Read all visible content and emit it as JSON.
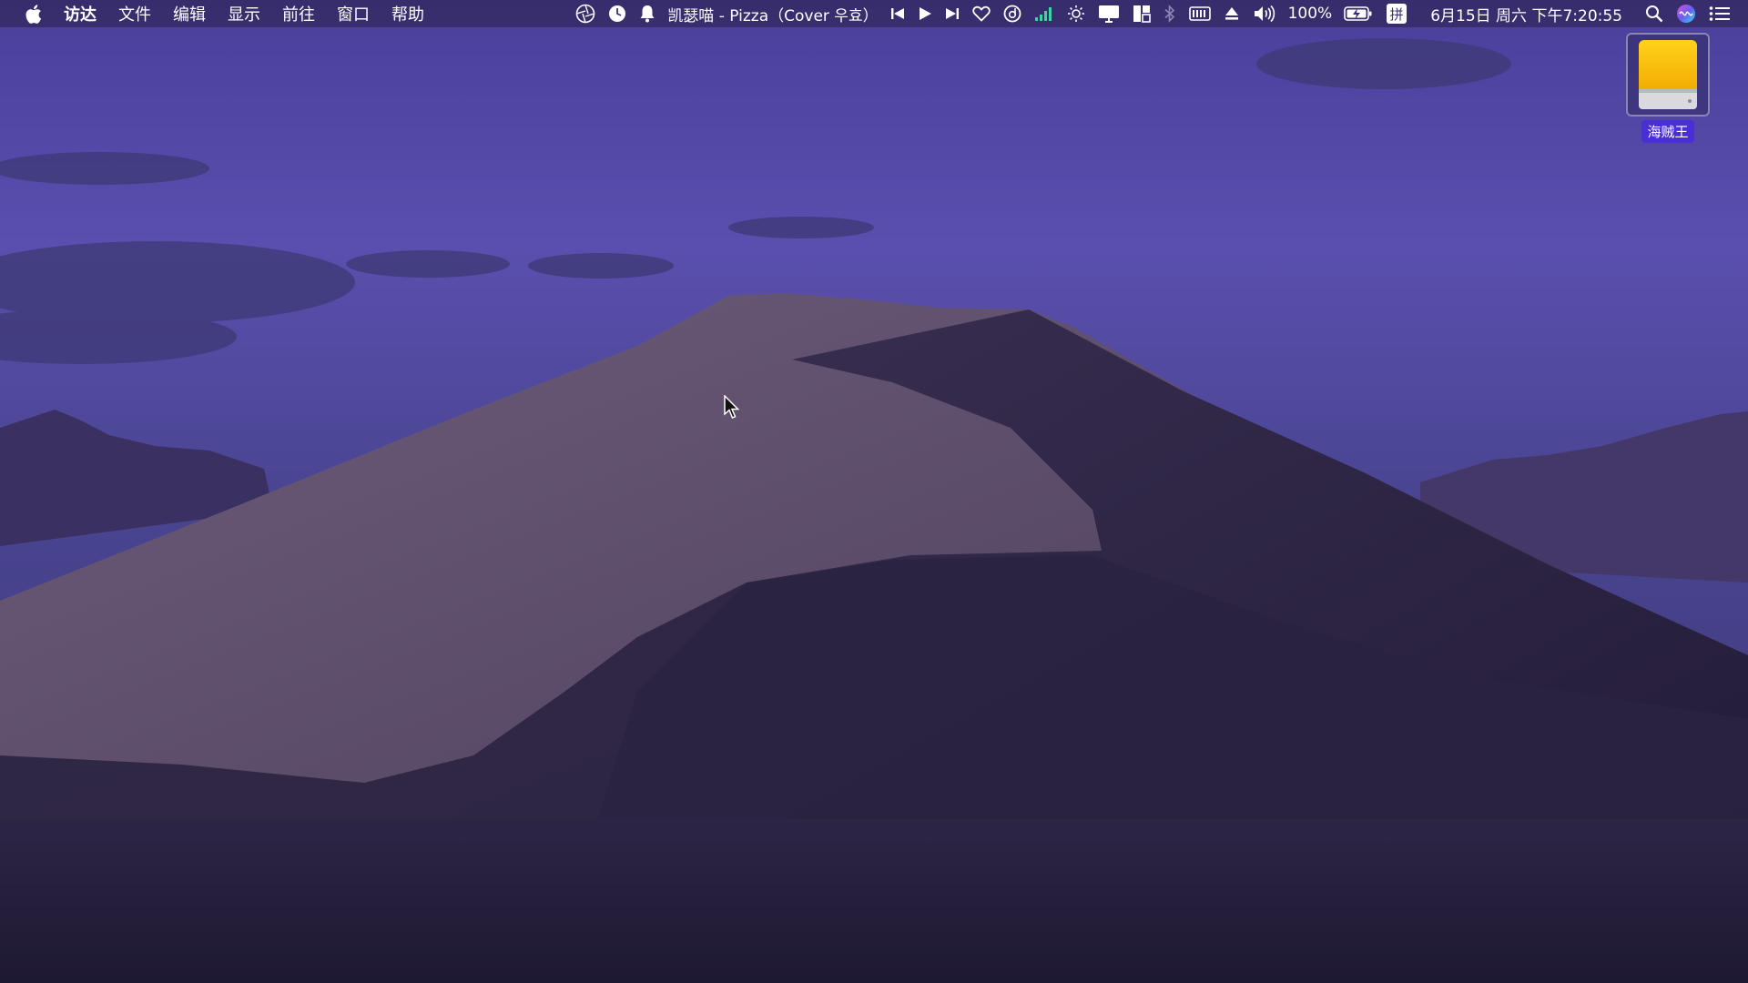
{
  "menubar": {
    "app_menus": [
      "访达",
      "文件",
      "编辑",
      "显示",
      "前往",
      "窗口",
      "帮助"
    ],
    "now_playing": "凯瑟喵 - Pizza（Cover 우효）",
    "battery_percent": "100%",
    "datetime": "6月15日 周六 下午7:20:55",
    "input_method": "拼",
    "icons": [
      "apple-icon",
      "aperture-icon",
      "clock-icon",
      "bell-icon",
      "previous-track-icon",
      "play-icon",
      "next-track-icon",
      "heart-icon",
      "lyrics-icon",
      "signal-bars-icon",
      "brightness-icon",
      "display-icon",
      "window-layout-icon",
      "bluetooth-icon",
      "memory-icon",
      "eject-icon",
      "volume-icon",
      "battery-icon",
      "input-method-icon",
      "spotlight-search-icon",
      "siri-icon",
      "notification-center-icon"
    ]
  },
  "desktop": {
    "drive_label": "海贼王",
    "drive_icon": "external-drive-icon"
  },
  "colors": {
    "sky_top": "#4a3f9a",
    "sky_mid": "#5b50ae",
    "dune_light": "#5e5068",
    "dune_dark": "#2a2340",
    "drive_yellow": "#f5b800",
    "label_highlight": "#4b2fd6"
  }
}
